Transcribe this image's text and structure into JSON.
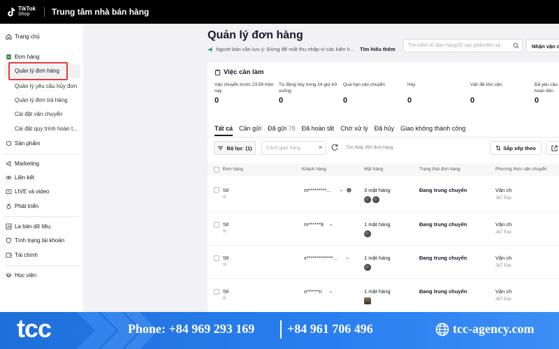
{
  "topbar": {
    "logo_line1": "TikTok",
    "logo_line2": "Shop",
    "title": "Trung tâm nhà bán hàng"
  },
  "sidebar": {
    "home": "Trang chủ",
    "orders": "Đơn hàng",
    "orders_sub": [
      "Quản lý đơn hàng",
      "Quản lý yêu cầu hủy đơn",
      "Quản lý đơn trả hàng",
      "Cài đặt vận chuyển",
      "Cài đặt quy trình hoàn t..."
    ],
    "products": "Sản phẩm",
    "marketing": "Marketing",
    "affiliate": "Liên kết",
    "live_video": "LIVE và video",
    "growth": "Phát triển",
    "data_compass": "La bàn dữ liệu",
    "account_health": "Tình trạng tài khoản",
    "finance": "Tài chính",
    "academy": "Học viện"
  },
  "header": {
    "title": "Quản lý đơn hàng",
    "notice": "Người bán cần lưu ý: Đừng để mất thu nhập vì các kiện h...",
    "notice_link": "Tìm hiểu thêm",
    "search_placeholder": "Tìm kiếm ID đơn hàng/ID sản phẩm/tên sả",
    "ship_button": "Nhận vận c"
  },
  "todo": {
    "title": "Việc cần làm",
    "items": [
      {
        "label": "Vận chuyển trước 23:59 hôm nay",
        "value": "0"
      },
      {
        "label": "Tự động hủy trong 24 giờ trở xuống",
        "value": "0"
      },
      {
        "label": "Quá hạn vận chuyển",
        "value": "0"
      },
      {
        "label": "Hủy",
        "value": "0"
      },
      {
        "label": "Vấn đề kho vận",
        "value": "0"
      },
      {
        "label": "Đã yêu cầu hoàn tiền",
        "value": "0"
      }
    ]
  },
  "tabs": [
    {
      "label": "Tất cả",
      "count": ""
    },
    {
      "label": "Cần gửi",
      "count": ""
    },
    {
      "label": "Đã gửi",
      "count": "78"
    },
    {
      "label": "Đã hoàn tất",
      "count": ""
    },
    {
      "label": "Chờ xử lý",
      "count": ""
    },
    {
      "label": "Đã hủy",
      "count": ""
    },
    {
      "label": "Giao không thành công",
      "count": ""
    }
  ],
  "toolbar": {
    "filter_label": "Bộ lọc",
    "filter_count": "(1)",
    "method_placeholder": "Cách giao hàng",
    "found_text": "Tìm thấy 350 đơn hàng",
    "sort_label": "Sắp xếp theo"
  },
  "table": {
    "headers": [
      "Đơn hàng",
      "Khách hàng",
      "Mặt hàng",
      "Trạng thái đơn hàng",
      "Phương thức vận chuyển"
    ],
    "rows": [
      {
        "order": "58",
        "order_sub": "th",
        "customer": "m*********...",
        "items": "3 mặt hàng",
        "status": "Đang trung chuyển",
        "shipping": "Vận ch",
        "carrier": "J&T Exp"
      },
      {
        "order": "58",
        "order_sub": "th",
        "customer": "m******9",
        "items": "1 mặt hàng",
        "status": "Đang trung chuyển",
        "shipping": "Vận ch",
        "carrier": "J&T Exp"
      },
      {
        "order": "58",
        "order_sub": "th",
        "customer": "x*************...",
        "items": "1 mặt hàng",
        "status": "Đang trung chuyển",
        "shipping": "Vận ch",
        "carrier": "J&T Exp"
      },
      {
        "order": "58",
        "order_sub": "th",
        "customer": "o******n",
        "items": "1 mặt hàng",
        "status": "Đang trung chuyển",
        "shipping": "Vận ch",
        "carrier": "J&T Exp"
      }
    ]
  },
  "banner": {
    "brand": "tcc",
    "phone1": "Phone: +84 969 293 169",
    "phone2": "+84 961 706 496",
    "website": "tcc-agency.com"
  },
  "colors": {
    "highlight": "#e53935",
    "banner": "#2a7ff0",
    "topbar": "#000000"
  }
}
